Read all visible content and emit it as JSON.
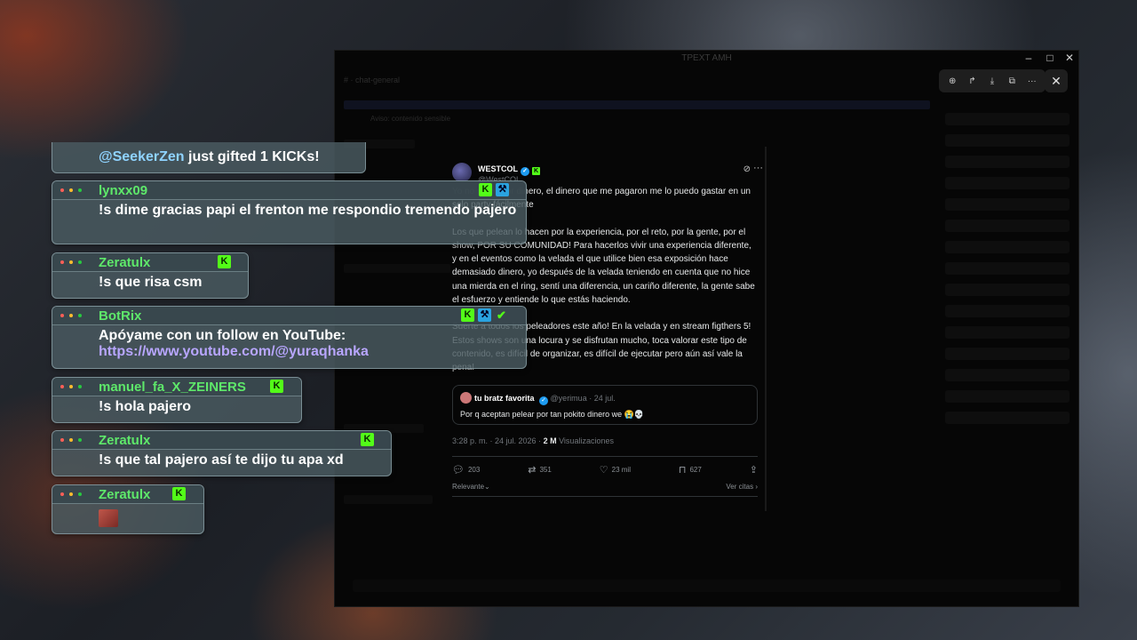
{
  "window": {
    "title": "TPEXT AMH",
    "controls": {
      "minimize": "–",
      "maximize": "□",
      "close": "✕"
    },
    "dim_channel_text": "#  ·  chat-general",
    "dim_banner_text": "Aviso: contenido sensible"
  },
  "viewer_toolbar": {
    "icons": [
      "zoom-in-icon",
      "share-icon",
      "download-icon",
      "open-external-icon",
      "more-icon"
    ],
    "glyphs": {
      "zoom": "⊕",
      "share": "↱",
      "download": "⤓",
      "external": "⧉",
      "more": "···",
      "close": "✕"
    }
  },
  "tweet": {
    "author_name": "WESTCOL",
    "author_handle": "@WestCOL",
    "body": [
      "Yo no pelee por dinero, el dinero que me pagaron me lo puedo gastar en un solo party fácilmente",
      "Los que pelean lo hacen por la experiencia, por el reto, por la gente, por el show, POR SU COMUNIDAD! Para hacerlos vivir una experiencia diferente, y en el eventos como la velada el que utilice bien esa exposición hace demasiado dinero, yo después de la velada teniendo en cuenta que no hice una mierda en el ring, sentí una diferencia, un cariño diferente, la gente sabe el esfuerzo y entiende lo que estás haciendo.",
      "Suerte a todos los peleadores este año! En la velada y en stream figthers 5! Estos shows son una locura y se disfrutan mucho, toca valorar este tipo de contenido, es difícil de organizar, es difícil de ejecutar pero aún así vale la pena!"
    ],
    "quote": {
      "name": "tu bratz favorita",
      "handle": "@yerimua",
      "date": "· 24 jul.",
      "text": "Por q aceptan pelear por tan pokito dinero we 😭💀"
    },
    "meta_time": "3:28 p. m. · 24 jul. 2026 · ",
    "meta_views_count": "2 M",
    "meta_views_label": "Visualizaciones",
    "actions": {
      "replies": "203",
      "reposts": "351",
      "likes": "23 mil",
      "bookmarks": "627"
    },
    "sort_label": "Relevante",
    "quotes_link": "Ver citas"
  },
  "chat": {
    "gift": {
      "user": "@SeekerZen",
      "text": " just gifted 1 KICKs!"
    },
    "messages": [
      {
        "user": "lynxx09",
        "color": "#5ee86a",
        "text": "!s dime gracias papi el frenton me respondio tremendo pajero"
      },
      {
        "user": "Zeratulx",
        "color": "#5ee86a",
        "text": "!s que risa csm"
      },
      {
        "user": "BotRix",
        "color": "#5ee86a",
        "text": "Apóyame con un follow en YouTube:",
        "link": "https://www.youtube.com/@yuraqhanka"
      },
      {
        "user": "manuel_fa_X_ZEINERS",
        "color": "#5ee86a",
        "text": "!s hola pajero"
      },
      {
        "user": "Zeratulx",
        "color": "#5ee86a",
        "text": "!s que tal pajero así te dijo tu apa xd"
      },
      {
        "user": "Zeratulx",
        "color": "#5ee86a",
        "text": ""
      }
    ]
  },
  "colors": {
    "kick_green": "#53fc18",
    "x_blue": "#1d9bf0",
    "chat_user": "#5ee86a"
  }
}
